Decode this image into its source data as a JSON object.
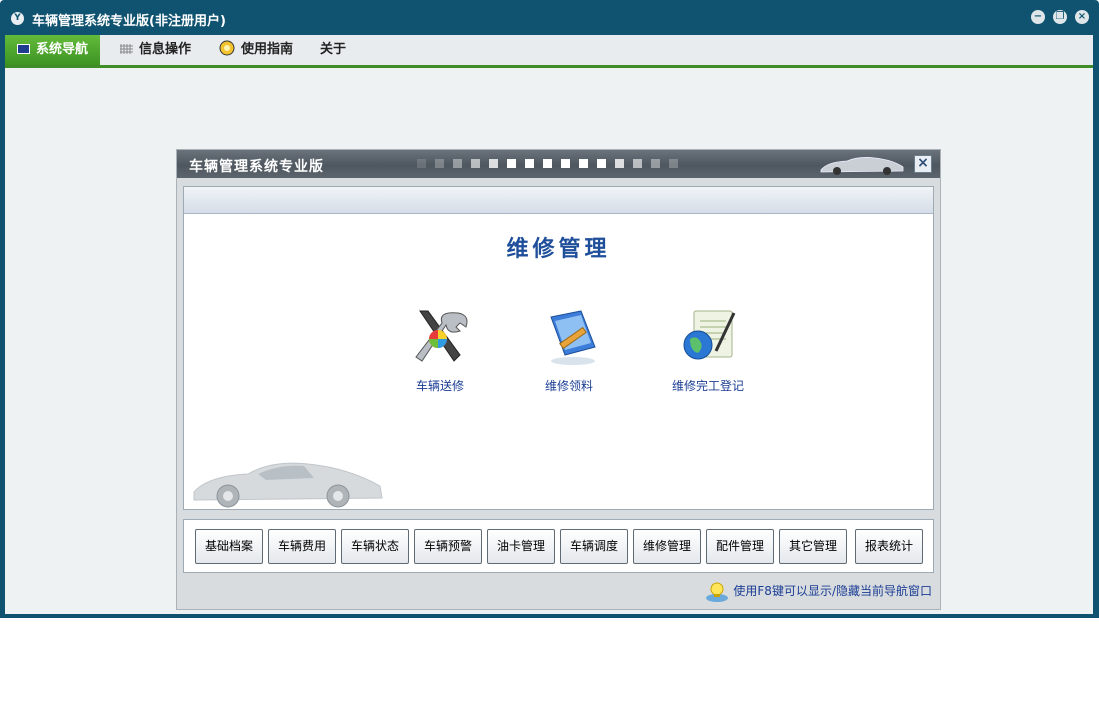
{
  "window": {
    "title": "车辆管理系统专业版(非注册用户)"
  },
  "menu": [
    {
      "label": "系统导航",
      "icon": "monitor-icon"
    },
    {
      "label": "信息操作",
      "icon": "grid-icon"
    },
    {
      "label": "使用指南",
      "icon": "guide-icon"
    },
    {
      "label": "关于",
      "icon": ""
    }
  ],
  "nav_window": {
    "title": "车辆管理系统专业版",
    "section_title": "维修管理",
    "functions": [
      {
        "label": "车辆送修",
        "icon": "tools-icon"
      },
      {
        "label": "维修领料",
        "icon": "materials-icon"
      },
      {
        "label": "维修完工登记",
        "icon": "completion-register-icon"
      }
    ],
    "modules": [
      "基础档案",
      "车辆费用",
      "车辆状态",
      "车辆预警",
      "油卡管理",
      "车辆调度",
      "维修管理",
      "配件管理",
      "其它管理",
      "报表统计"
    ],
    "tip": "使用F8键可以显示/隐藏当前导航窗口"
  }
}
